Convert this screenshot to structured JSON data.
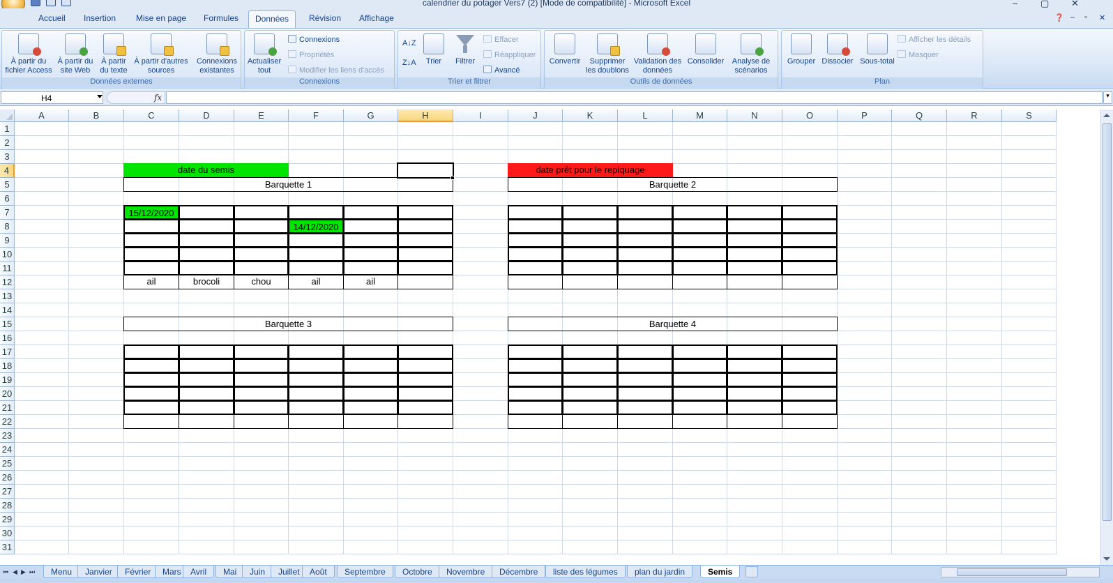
{
  "window": {
    "title": "calendrier du potager Vers7 (2)  [Mode de compatibilité] - Microsoft Excel",
    "help_icon": "question-icon",
    "minimize": "–",
    "restore": "▢",
    "close": "✕"
  },
  "ribbon_tabs": [
    "Accueil",
    "Insertion",
    "Mise en page",
    "Formules",
    "Données",
    "Révision",
    "Affichage"
  ],
  "active_ribbon_tab": "Données",
  "ribbon": {
    "donnees_externes": {
      "label": "Données externes",
      "access": "À partir du fichier Access",
      "web": "À partir du site Web",
      "texte": "À partir du texte",
      "autres": "À partir d'autres sources",
      "connexions_existantes": "Connexions existantes"
    },
    "connexions": {
      "label": "Connexions",
      "actualiser": "Actualiser tout",
      "connexions": "Connexions",
      "proprietes": "Propriétés",
      "modifier_liens": "Modifier les liens d'accès"
    },
    "trier_filtrer": {
      "label": "Trier et filtrer",
      "trier": "Trier",
      "filtrer": "Filtrer",
      "effacer": "Effacer",
      "reappliquer": "Réappliquer",
      "avance": "Avancé"
    },
    "outils_donnees": {
      "label": "Outils de données",
      "convertir": "Convertir",
      "supprimer_doublons": "Supprimer les doublons",
      "validation": "Validation des données",
      "consolider": "Consolider",
      "analyse": "Analyse de scénarios"
    },
    "plan": {
      "label": "Plan",
      "grouper": "Grouper",
      "dissocier": "Dissocier",
      "sous_total": "Sous-total",
      "afficher_details": "Afficher les détails",
      "masquer": "Masquer"
    }
  },
  "formula_bar": {
    "name_box": "H4",
    "fx": "fx",
    "formula": ""
  },
  "columns": [
    "A",
    "B",
    "C",
    "D",
    "E",
    "F",
    "G",
    "H",
    "I",
    "J",
    "K",
    "L",
    "M",
    "N",
    "O",
    "P",
    "Q",
    "R",
    "S"
  ],
  "selected_column": "H",
  "selected_row": 4,
  "row_count": 31,
  "cells": {
    "legend_semis": "date du semis",
    "legend_repiquage": "date prêt pour le repiquage",
    "barquette1": "Barquette 1",
    "barquette2": "Barquette 2",
    "barquette3": "Barquette 3",
    "barquette4": "Barquette 4",
    "c7": "15/12/2020",
    "f8": "14/12/2020",
    "c12": "ail",
    "d12": "brocoli",
    "e12": "chou",
    "f12": "ail",
    "g12": "ail"
  },
  "colors": {
    "semis_fill": "#00e400",
    "repiquage_fill": "#ff1a1a"
  },
  "sheet_tabs": [
    "Menu",
    "Janvier",
    "Février",
    "Mars",
    "Avril",
    "Mai",
    "Juin",
    "Juillet",
    "Août",
    "Septembre",
    "Octobre",
    "Novembre",
    "Décembre",
    "liste des légumes",
    "plan du jardin",
    "Semis"
  ],
  "active_sheet": "Semis"
}
